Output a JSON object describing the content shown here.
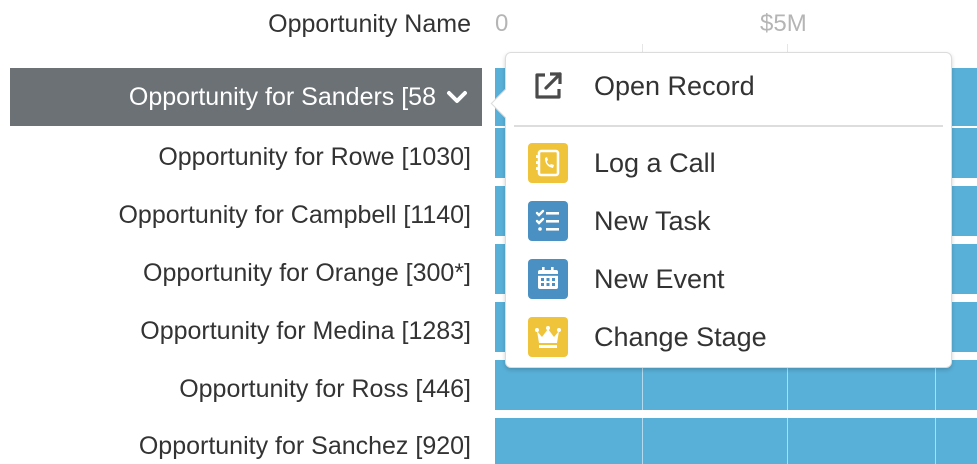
{
  "header": {
    "axis_title": "Opportunity Name",
    "ticks": [
      "0",
      "$5M"
    ]
  },
  "rows": [
    {
      "label": "Opportunity for Sanders [58",
      "selected": true
    },
    {
      "label": "Opportunity for Rowe [1030]"
    },
    {
      "label": "Opportunity for Campbell [1140]"
    },
    {
      "label": "Opportunity for Orange [300*]"
    },
    {
      "label": "Opportunity for Medina [1283]"
    },
    {
      "label": "Opportunity for Ross [446]"
    },
    {
      "label": "Opportunity for Sanchez [920]"
    }
  ],
  "menu": {
    "items": [
      {
        "label": "Open Record",
        "icon": "external-link-icon"
      },
      {
        "label": "Log a Call",
        "icon": "log-call-icon",
        "color": "#f0c43a"
      },
      {
        "label": "New Task",
        "icon": "new-task-icon",
        "color": "#4a90c2"
      },
      {
        "label": "New Event",
        "icon": "new-event-icon",
        "color": "#4a90c2"
      },
      {
        "label": "Change Stage",
        "icon": "crown-icon",
        "color": "#f0c43a"
      }
    ]
  },
  "colors": {
    "bar": "#58b0d8",
    "selected_row": "#6b7175"
  }
}
